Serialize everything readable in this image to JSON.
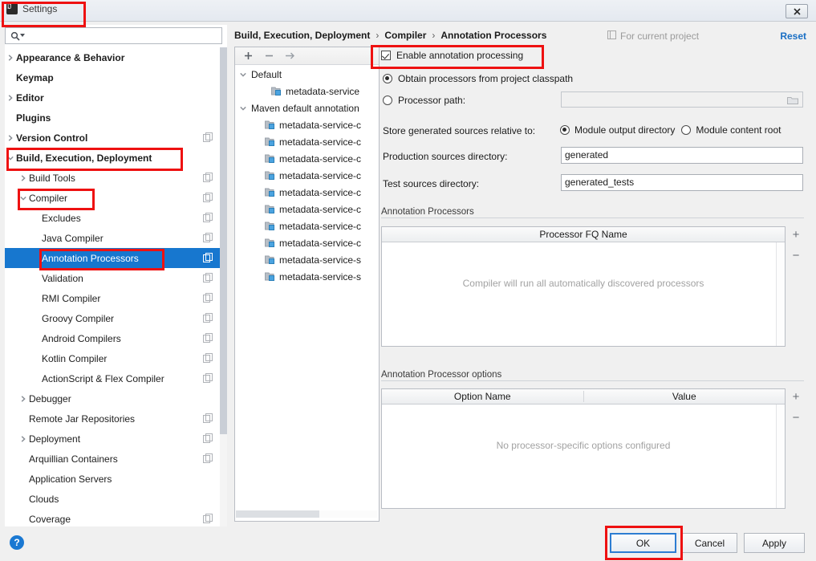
{
  "window": {
    "title": "Settings",
    "app_icon": "intellij-icon",
    "close_label": "✕"
  },
  "sidebar": {
    "search": {
      "placeholder": "",
      "value": "",
      "icon": "search-icon"
    },
    "items": [
      {
        "label": "Appearance & Behavior",
        "indent": 0,
        "arrow": "right",
        "bold": true,
        "gear": false,
        "selected": false
      },
      {
        "label": "Keymap",
        "indent": 0,
        "arrow": "none",
        "bold": true,
        "gear": false,
        "selected": false
      },
      {
        "label": "Editor",
        "indent": 0,
        "arrow": "right",
        "bold": true,
        "gear": false,
        "selected": false
      },
      {
        "label": "Plugins",
        "indent": 0,
        "arrow": "none",
        "bold": true,
        "gear": false,
        "selected": false
      },
      {
        "label": "Version Control",
        "indent": 0,
        "arrow": "right",
        "bold": true,
        "gear": true,
        "selected": false
      },
      {
        "label": "Build, Execution, Deployment",
        "indent": 0,
        "arrow": "down",
        "bold": true,
        "gear": false,
        "selected": false
      },
      {
        "label": "Build Tools",
        "indent": 1,
        "arrow": "right",
        "bold": false,
        "gear": true,
        "selected": false
      },
      {
        "label": "Compiler",
        "indent": 1,
        "arrow": "down",
        "bold": false,
        "gear": true,
        "selected": false
      },
      {
        "label": "Excludes",
        "indent": 2,
        "arrow": "none",
        "bold": false,
        "gear": true,
        "selected": false
      },
      {
        "label": "Java Compiler",
        "indent": 2,
        "arrow": "none",
        "bold": false,
        "gear": true,
        "selected": false
      },
      {
        "label": "Annotation Processors",
        "indent": 2,
        "arrow": "none",
        "bold": false,
        "gear": true,
        "selected": true
      },
      {
        "label": "Validation",
        "indent": 2,
        "arrow": "none",
        "bold": false,
        "gear": true,
        "selected": false
      },
      {
        "label": "RMI Compiler",
        "indent": 2,
        "arrow": "none",
        "bold": false,
        "gear": true,
        "selected": false
      },
      {
        "label": "Groovy Compiler",
        "indent": 2,
        "arrow": "none",
        "bold": false,
        "gear": true,
        "selected": false
      },
      {
        "label": "Android Compilers",
        "indent": 2,
        "arrow": "none",
        "bold": false,
        "gear": true,
        "selected": false
      },
      {
        "label": "Kotlin Compiler",
        "indent": 2,
        "arrow": "none",
        "bold": false,
        "gear": true,
        "selected": false
      },
      {
        "label": "ActionScript & Flex Compiler",
        "indent": 2,
        "arrow": "none",
        "bold": false,
        "gear": true,
        "selected": false
      },
      {
        "label": "Debugger",
        "indent": 1,
        "arrow": "right",
        "bold": false,
        "gear": false,
        "selected": false
      },
      {
        "label": "Remote Jar Repositories",
        "indent": 1,
        "arrow": "none",
        "bold": false,
        "gear": true,
        "selected": false
      },
      {
        "label": "Deployment",
        "indent": 1,
        "arrow": "right",
        "bold": false,
        "gear": true,
        "selected": false
      },
      {
        "label": "Arquillian Containers",
        "indent": 1,
        "arrow": "none",
        "bold": false,
        "gear": true,
        "selected": false
      },
      {
        "label": "Application Servers",
        "indent": 1,
        "arrow": "none",
        "bold": false,
        "gear": false,
        "selected": false
      },
      {
        "label": "Clouds",
        "indent": 1,
        "arrow": "none",
        "bold": false,
        "gear": false,
        "selected": false
      },
      {
        "label": "Coverage",
        "indent": 1,
        "arrow": "none",
        "bold": false,
        "gear": true,
        "selected": false
      }
    ]
  },
  "header": {
    "breadcrumb": [
      "Build, Execution, Deployment",
      "Compiler",
      "Annotation Processors"
    ],
    "separator": "›",
    "scope_label": "For current project",
    "scope_icon": "project-scope-icon",
    "reset_label": "Reset"
  },
  "modules_panel": {
    "toolbar": {
      "add": "+",
      "remove": "−",
      "move": "→"
    },
    "rows": [
      {
        "label": "Default",
        "type": "group",
        "arrow": "down"
      },
      {
        "label": "metadata-service",
        "type": "module",
        "indent": 2
      },
      {
        "label": "Maven default annotation",
        "type": "group",
        "arrow": "down"
      },
      {
        "label": "metadata-service-c",
        "type": "module",
        "indent": 1
      },
      {
        "label": "metadata-service-c",
        "type": "module",
        "indent": 1
      },
      {
        "label": "metadata-service-c",
        "type": "module",
        "indent": 1
      },
      {
        "label": "metadata-service-c",
        "type": "module",
        "indent": 1
      },
      {
        "label": "metadata-service-c",
        "type": "module",
        "indent": 1
      },
      {
        "label": "metadata-service-c",
        "type": "module",
        "indent": 1
      },
      {
        "label": "metadata-service-c",
        "type": "module",
        "indent": 1
      },
      {
        "label": "metadata-service-c",
        "type": "module",
        "indent": 1
      },
      {
        "label": "metadata-service-s",
        "type": "module",
        "indent": 1
      },
      {
        "label": "metadata-service-s",
        "type": "module",
        "indent": 1
      }
    ]
  },
  "settings": {
    "enable_annotation_processing": {
      "label": "Enable annotation processing",
      "checked": true
    },
    "processor_source": {
      "classpath": {
        "label": "Obtain processors from project classpath",
        "selected": true
      },
      "path": {
        "label": "Processor path:",
        "selected": false,
        "value": "",
        "browse_icon": "folder-icon"
      }
    },
    "store_relative": {
      "label": "Store generated sources relative to:",
      "options": [
        {
          "label": "Module output directory",
          "selected": true
        },
        {
          "label": "Module content root",
          "selected": false
        }
      ]
    },
    "production_sources": {
      "label": "Production sources directory:",
      "value": "generated"
    },
    "test_sources": {
      "label": "Test sources directory:",
      "value": "generated_tests"
    }
  },
  "processors_table": {
    "title": "Annotation Processors",
    "columns": [
      "Processor FQ Name"
    ],
    "rows": [],
    "empty_text": "Compiler will run all automatically discovered processors",
    "add_label": "+",
    "remove_label": "−"
  },
  "options_table": {
    "title": "Annotation Processor options",
    "columns": [
      "Option Name",
      "Value"
    ],
    "rows": [],
    "empty_text": "No processor-specific options configured",
    "add_label": "+",
    "remove_label": "−"
  },
  "footer": {
    "help_label": "?",
    "ok_label": "OK",
    "cancel_label": "Cancel",
    "apply_label": "Apply"
  },
  "colors": {
    "selection_blue": "#1777cf",
    "link_blue": "#1a6fc4",
    "annotation_red": "#ee1111",
    "ok_border": "#2d7dd2"
  }
}
